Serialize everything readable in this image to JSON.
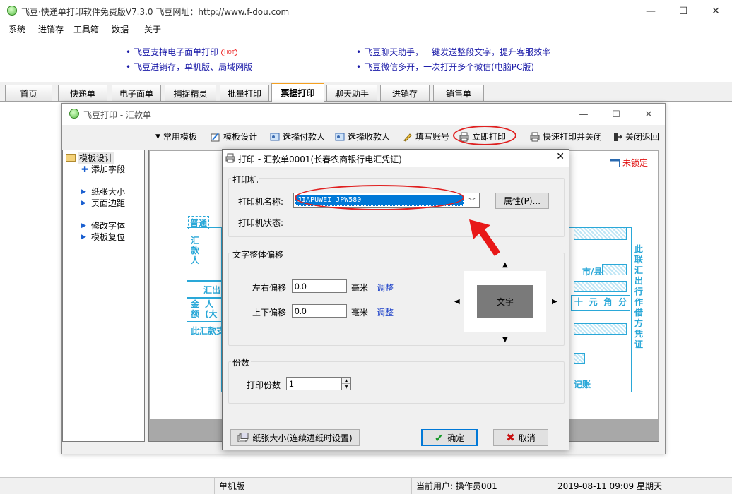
{
  "app": {
    "title": "飞豆·快递单打印软件免费版V7.3.0  飞豆网址：http://www.f-dou.com",
    "win_min": "—",
    "win_max": "☐",
    "win_close": "✕"
  },
  "menu": [
    "系统",
    "进销存",
    "工具箱",
    "数据",
    "关于"
  ],
  "news": {
    "left1": "飞豆支持电子面单打印",
    "hot": "HOT",
    "left2": "飞豆进销存，单机版、局域网版",
    "right1": "飞豆聊天助手，一键发送整段文字，提升客服效率",
    "right2": "飞豆微信多开，一次打开多个微信(电脑PC版)",
    "bullet": "•"
  },
  "tabs": [
    "首页",
    "快递单",
    "电子面单",
    "捕捉精灵",
    "批量打印",
    "票据打印",
    "聊天助手",
    "进销存",
    "销售单"
  ],
  "child": {
    "title": "飞豆打印 - 汇款单",
    "toolbar": [
      "常用模板",
      "模板设计",
      "选择付款人",
      "选择收款人",
      "填写账号",
      "立即打印",
      "快速打印并关闭",
      "关闭返回"
    ],
    "tree": {
      "root": "模板设计",
      "items": [
        "添加字段",
        "纸张大小",
        "页面边距",
        "修改字体",
        "模板复位"
      ]
    },
    "lock_label": "未锁定",
    "form": {
      "putong": "普通",
      "huikuanren": "汇款人",
      "jine": "金额",
      "huichu": "汇出",
      "ren_da": "人(大",
      "footer_note": "此汇款支",
      "city": "市/县",
      "digits": [
        "十",
        "元",
        "角",
        "分"
      ],
      "side_note": "此联汇出行作借方凭证",
      "jizhang": "记账"
    }
  },
  "dialog": {
    "title": "打印 - 汇款单0001(长春农商银行电汇凭证)",
    "close": "✕",
    "printer_group": "打印机",
    "printer_name_label": "打印机名称:",
    "printer_name_value": "JIAPUWEI JPW580",
    "props_button": "属性(P)...",
    "printer_status_label": "打印机状态:",
    "offset_group": "文字整体偏移",
    "lr_label": "左右偏移",
    "lr_value": "0.0",
    "ud_label": "上下偏移",
    "ud_value": "0.0",
    "unit": "毫米",
    "adjust": "调整",
    "preview_text": "文字",
    "copies_group": "份数",
    "copies_label": "打印份数",
    "copies_value": "1",
    "paper_button": "纸张大小(连续进纸时设置)",
    "ok_button": "确定",
    "cancel_button": "取消"
  },
  "status": {
    "mode": "单机版",
    "user": "当前用户: 操作员001",
    "datetime": "2019-08-11 09:09 星期天"
  },
  "colors": {
    "accent_orange": "#f5a020",
    "annotation_red": "#e02020",
    "link_blue": "#1a1aa8",
    "form_cyan": "#2aa8d8",
    "selection_blue": "#0078d7"
  }
}
